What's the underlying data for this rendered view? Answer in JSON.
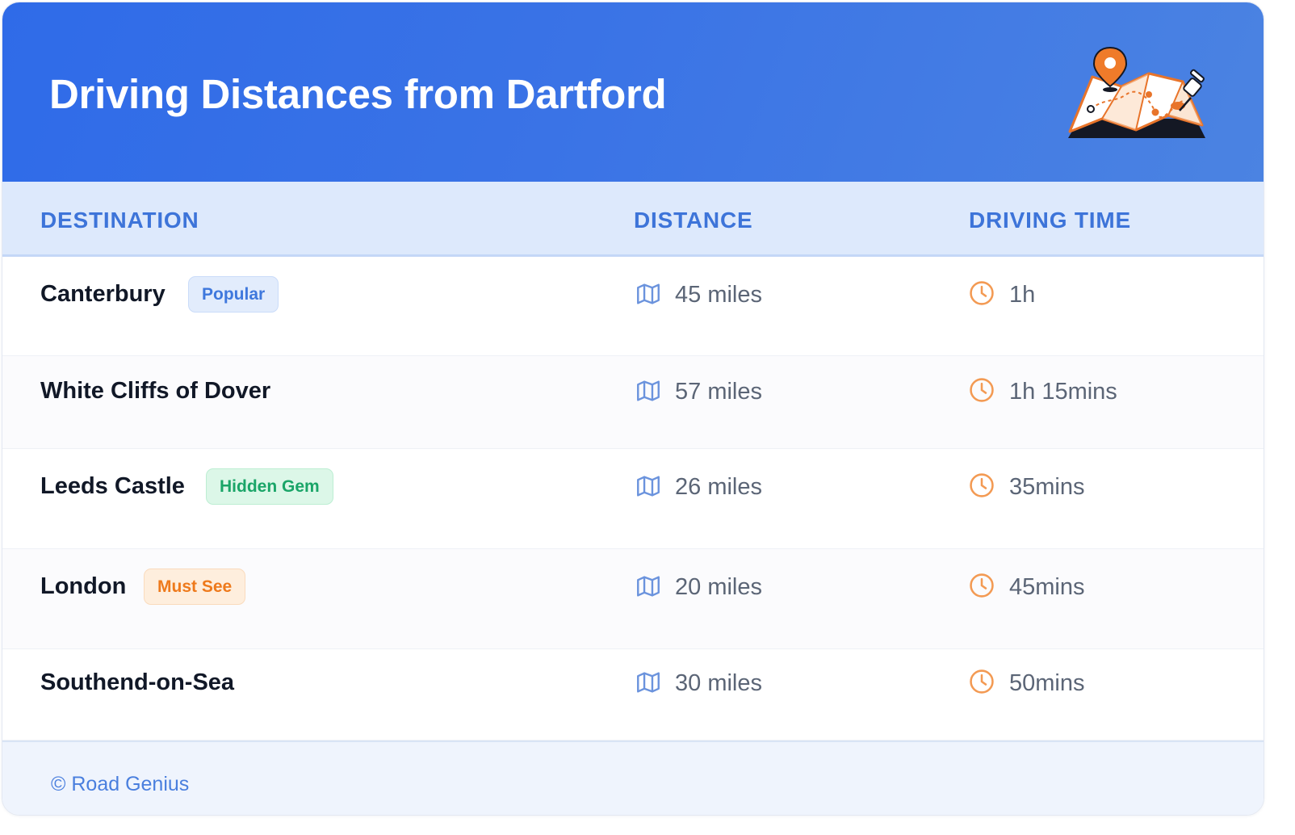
{
  "header": {
    "title": "Driving Distances from Dartford",
    "illustration": "map-with-pins-illustration"
  },
  "table": {
    "columns": [
      "DESTINATION",
      "DISTANCE",
      "DRIVING TIME"
    ],
    "rows": [
      {
        "destination": "Canterbury",
        "badge": "Popular",
        "badge_style": "blue",
        "distance": "45 miles",
        "time": "1h"
      },
      {
        "destination": "White Cliffs of Dover",
        "badge": "",
        "badge_style": "",
        "distance": "57 miles",
        "time": "1h 15mins"
      },
      {
        "destination": "Leeds Castle",
        "badge": "Hidden Gem",
        "badge_style": "green",
        "distance": "26 miles",
        "time": "35mins"
      },
      {
        "destination": "London",
        "badge": "Must See",
        "badge_style": "orange",
        "distance": "20 miles",
        "time": "45mins"
      },
      {
        "destination": "Southend-on-Sea",
        "badge": "",
        "badge_style": "",
        "distance": "30 miles",
        "time": "50mins"
      }
    ]
  },
  "icons": {
    "distance": "map-icon",
    "time": "clock-icon"
  },
  "footer": {
    "credit": "© Road Genius"
  },
  "colors": {
    "header_gradient_start": "#2f6be8",
    "header_gradient_end": "#4b83e2",
    "column_header_text": "#3d74d9",
    "distance_icon": "#6b93dd",
    "time_icon": "#f39a53",
    "badge_blue": "#3f78dd",
    "badge_green": "#1aa568",
    "badge_orange": "#ee7a1c"
  }
}
